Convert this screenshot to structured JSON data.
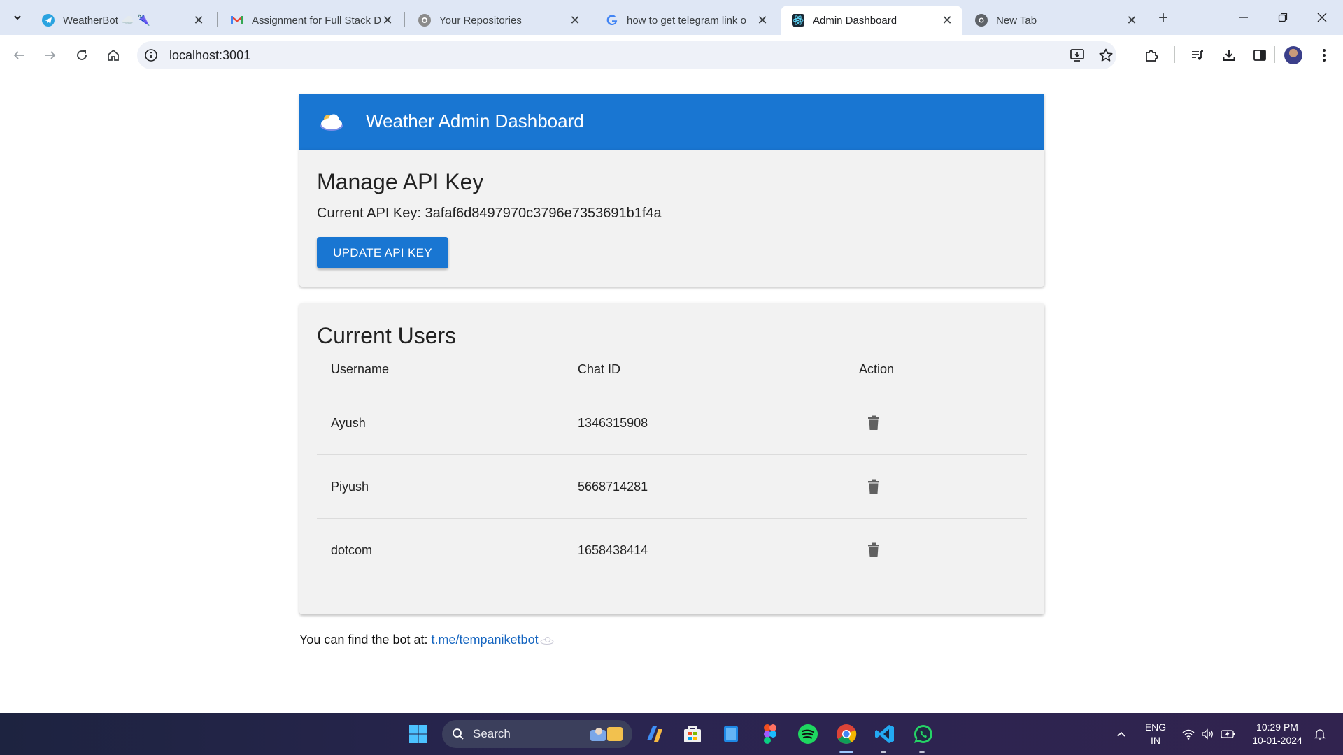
{
  "browser": {
    "tabs": [
      {
        "title": "WeatherBot ☁️ 🌂",
        "favicon": "telegram-icon",
        "color": "#2aa3e0"
      },
      {
        "title": "Assignment for Full Stack D",
        "favicon": "gmail-icon",
        "color": "#ea4335"
      },
      {
        "title": "Your Repositories",
        "favicon": "github-icon",
        "color": "#6e6e6e"
      },
      {
        "title": "how to get telegram link o",
        "favicon": "google-icon",
        "color": "#4285f4"
      },
      {
        "title": "Admin Dashboard",
        "favicon": "react-icon",
        "color": "#1a2733",
        "active": true
      },
      {
        "title": "New Tab",
        "favicon": "chrome-icon",
        "color": "#5f6368"
      }
    ],
    "url": "localhost:3001"
  },
  "app": {
    "title": "Weather Admin Dashboard",
    "brand_color": "#1976d2"
  },
  "api_section": {
    "heading": "Manage API Key",
    "key_label": "Current API Key:",
    "key_value": "3afaf6d8497970c3796e7353691b1f4a",
    "update_button": "UPDATE API KEY"
  },
  "users_section": {
    "heading": "Current Users",
    "columns": [
      "Username",
      "Chat ID",
      "Action"
    ],
    "rows": [
      {
        "username": "Ayush",
        "chat_id": "1346315908",
        "action_icon": "delete-icon"
      },
      {
        "username": "Piyush",
        "chat_id": "5668714281",
        "action_icon": "delete-icon"
      },
      {
        "username": "dotcom",
        "chat_id": "1658438414",
        "action_icon": "delete-icon"
      }
    ]
  },
  "footer": {
    "prefix": "You can find the bot at:",
    "link_text": "t.me/tempaniketbot"
  },
  "taskbar": {
    "search_label": "Search",
    "language_line1": "ENG",
    "language_line2": "IN",
    "time": "10:29 PM",
    "date": "10-01-2024"
  }
}
